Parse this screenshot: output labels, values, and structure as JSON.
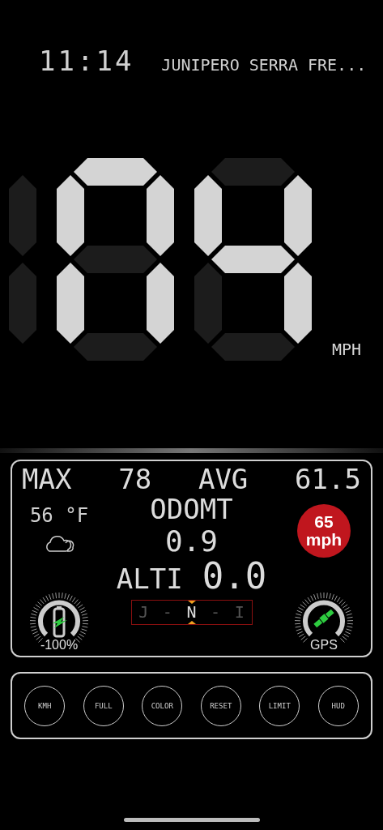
{
  "status": {
    "time": "11:14",
    "street": "JUNIPERO SERRA FRE..."
  },
  "speed": {
    "digits": [
      {
        "upper_right": false,
        "lower_right": false
      },
      {
        "top": true,
        "upper_right": true,
        "lower_right": true,
        "bottom": false,
        "lower_left": true,
        "upper_left": true,
        "middle": false
      },
      {
        "top": false,
        "upper_right": true,
        "lower_right": true,
        "bottom": false,
        "lower_left": false,
        "upper_left": true,
        "middle": true
      }
    ],
    "unit": "MPH"
  },
  "stats": [
    {
      "label": "MAX",
      "value": "78"
    },
    {
      "label": "AVG",
      "value": "61.5"
    }
  ],
  "weather": {
    "temperature": "56 °F"
  },
  "odometer": {
    "label": "ODOMT",
    "value": "0.9"
  },
  "altitude": {
    "label": "ALTI",
    "value": "0.0"
  },
  "compass": {
    "left": "J",
    "left_dash": "-",
    "center": "N",
    "right_dash": "-",
    "right": "I"
  },
  "speed_limit": {
    "value": "65",
    "unit": "mph"
  },
  "battery": {
    "reading": "-100%"
  },
  "gps": {
    "label": "GPS"
  },
  "buttons": [
    "KMH",
    "FULL",
    "COLOR",
    "RESET",
    "LIMIT",
    "HUD"
  ]
}
